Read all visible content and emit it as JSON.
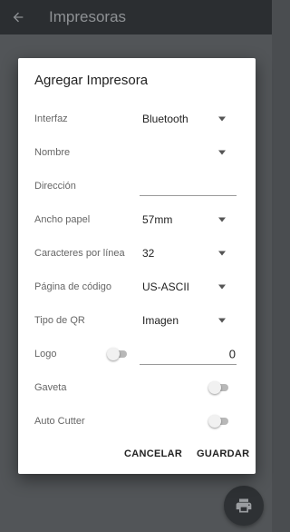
{
  "appbar": {
    "title": "Impresoras",
    "back_icon": "arrow-back-icon"
  },
  "dialog": {
    "title": "Agregar Impresora",
    "fields": {
      "interfaz": {
        "label": "Interfaz",
        "value": "Bluetooth"
      },
      "nombre": {
        "label": "Nombre",
        "value": ""
      },
      "direccion": {
        "label": "Dirección",
        "value": ""
      },
      "ancho_papel": {
        "label": "Ancho papel",
        "value": "57mm"
      },
      "caracteres": {
        "label": "Caracteres por línea",
        "value": "32"
      },
      "pagina_codigo": {
        "label": "Página de código",
        "value": "US-ASCII"
      },
      "tipo_qr": {
        "label": "Tipo de QR",
        "value": "Imagen"
      },
      "logo": {
        "label": "Logo",
        "enabled": false,
        "value": "0"
      },
      "gaveta": {
        "label": "Gaveta",
        "enabled": false
      },
      "auto_cutter": {
        "label": "Auto Cutter",
        "enabled": false
      }
    },
    "actions": {
      "cancel": "CANCELAR",
      "save": "GUARDAR"
    }
  },
  "fab": {
    "icon": "printer-icon"
  },
  "colors": {
    "appbar": "#2b2e31",
    "scrim": "#525558",
    "dialog": "#ffffff",
    "fab": "#2e3134"
  }
}
